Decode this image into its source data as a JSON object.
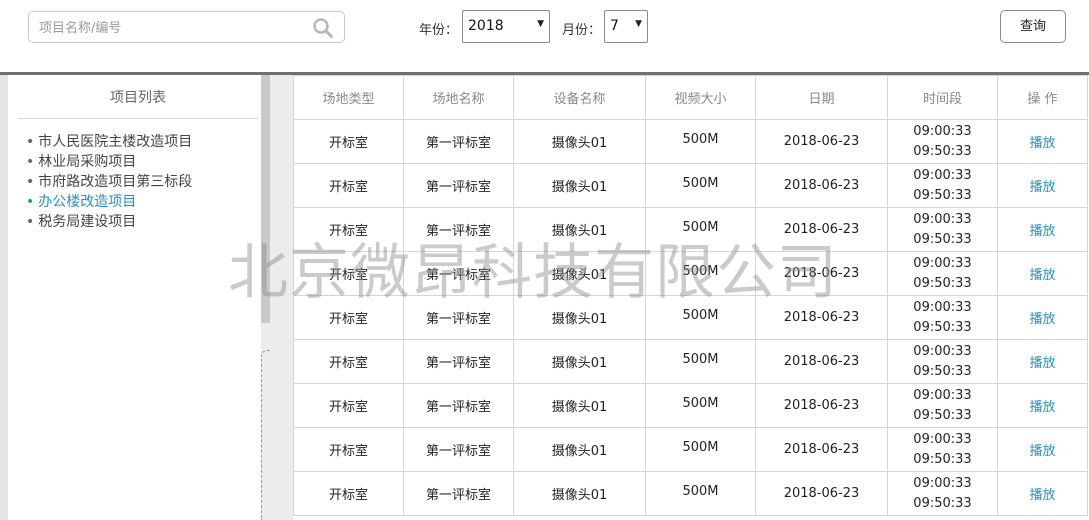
{
  "search": {
    "placeholder": "项目名称/编号",
    "value": ""
  },
  "filters": {
    "year_label": "年份：",
    "year_value": "2018",
    "month_label": "月份：",
    "month_value": "7"
  },
  "query_button": "查询",
  "sidebar": {
    "title": "项目列表",
    "items": [
      {
        "label": "市人民医院主楼改造项目",
        "active": false
      },
      {
        "label": "林业局采购项目",
        "active": false
      },
      {
        "label": "市府路改造项目第三标段",
        "active": false
      },
      {
        "label": "办公楼改造项目",
        "active": true
      },
      {
        "label": "税务局建设项目",
        "active": false
      }
    ]
  },
  "table": {
    "headers": [
      "场地类型",
      "场地名称",
      "设备名称",
      "视频大小",
      "日期",
      "时间段",
      "操 作"
    ],
    "rows": [
      {
        "venue_type": "开标室",
        "venue_name": "第一评标室",
        "device": "摄像头01",
        "size": "500M",
        "date": "2018-06-23",
        "start": "09:00:33",
        "end": "09:50:33",
        "action": "播放"
      },
      {
        "venue_type": "开标室",
        "venue_name": "第一评标室",
        "device": "摄像头01",
        "size": "500M",
        "date": "2018-06-23",
        "start": "09:00:33",
        "end": "09:50:33",
        "action": "播放"
      },
      {
        "venue_type": "开标室",
        "venue_name": "第一评标室",
        "device": "摄像头01",
        "size": "500M",
        "date": "2018-06-23",
        "start": "09:00:33",
        "end": "09:50:33",
        "action": "播放"
      },
      {
        "venue_type": "开标室",
        "venue_name": "第一评标室",
        "device": "摄像头01",
        "size": "500M",
        "date": "2018-06-23",
        "start": "09:00:33",
        "end": "09:50:33",
        "action": "播放"
      },
      {
        "venue_type": "开标室",
        "venue_name": "第一评标室",
        "device": "摄像头01",
        "size": "500M",
        "date": "2018-06-23",
        "start": "09:00:33",
        "end": "09:50:33",
        "action": "播放"
      },
      {
        "venue_type": "开标室",
        "venue_name": "第一评标室",
        "device": "摄像头01",
        "size": "500M",
        "date": "2018-06-23",
        "start": "09:00:33",
        "end": "09:50:33",
        "action": "播放"
      },
      {
        "venue_type": "开标室",
        "venue_name": "第一评标室",
        "device": "摄像头01",
        "size": "500M",
        "date": "2018-06-23",
        "start": "09:00:33",
        "end": "09:50:33",
        "action": "播放"
      },
      {
        "venue_type": "开标室",
        "venue_name": "第一评标室",
        "device": "摄像头01",
        "size": "500M",
        "date": "2018-06-23",
        "start": "09:00:33",
        "end": "09:50:33",
        "action": "播放"
      },
      {
        "venue_type": "开标室",
        "venue_name": "第一评标室",
        "device": "摄像头01",
        "size": "500M",
        "date": "2018-06-23",
        "start": "09:00:33",
        "end": "09:50:33",
        "action": "播放"
      }
    ]
  },
  "watermark": "北京微昂科技有限公司",
  "colors": {
    "accent": "#2b8fbe",
    "divider": "#6f6f6f"
  },
  "icons": {
    "search": "search-icon",
    "dropdown": "triangle-down-icon"
  }
}
